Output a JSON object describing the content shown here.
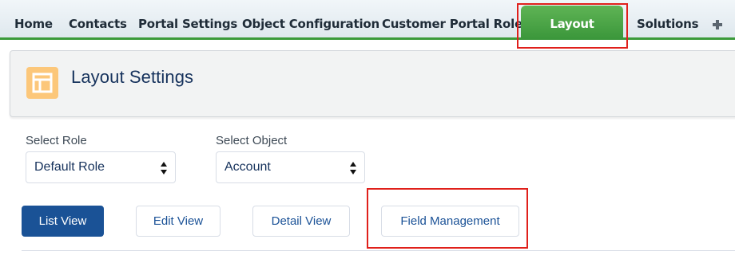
{
  "tabs": {
    "home": "Home",
    "contacts": "Contacts",
    "portal_settings": "Portal Settings",
    "object_configuration": "Object Configuration",
    "customer_portal_roles": "Customer Portal Roles",
    "layout_settings": "Layout Settings",
    "solutions": "Solutions",
    "more_icon": "plus-icon",
    "active_tab": "Layout Settings"
  },
  "header": {
    "title": "Layout Settings",
    "icon": "layout-icon",
    "icon_color": "#fcc77a"
  },
  "filters": {
    "role_label": "Select Role",
    "role_value": "Default Role",
    "object_label": "Select Object",
    "object_value": "Account"
  },
  "views": {
    "list": "List View",
    "edit": "Edit View",
    "detail": "Detail View",
    "field_management": "Field Management",
    "selected": "List View"
  },
  "colors": {
    "active_tab": "#3f9b3d",
    "primary_button": "#1a5296",
    "annotation": "#e0201b"
  }
}
